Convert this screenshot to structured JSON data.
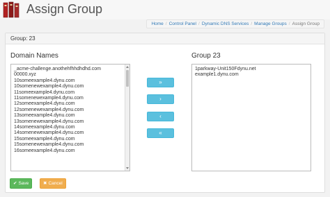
{
  "header": {
    "title": "Assign Group",
    "logo_icon": "books-icon"
  },
  "breadcrumb": [
    "Home",
    "Control Panel",
    "Dynamic DNS Services",
    "Manage Groups",
    "Assign Group"
  ],
  "panel": {
    "heading": "Group: 23"
  },
  "left_list": {
    "label": "Domain Names",
    "items": [
      "_acme-challenge.anothehfhhdhdhd.com",
      "00000.xyz",
      "10someexample4.dynu.com",
      "10somenewexample4.dynu.com",
      "11someexample4.dynu.com",
      "11somenewexample4.dynu.com",
      "12someexample4.dynu.com",
      "12somenewexample4.dynu.com",
      "13someexample4.dynu.com",
      "13somenewexample4.dynu.com",
      "14someexample4.dynu.com",
      "14somenewexample4.dynu.com",
      "15someexample4.dynu.com",
      "15somenewexample4.dynu.com",
      "16someexample4.dynu.com"
    ]
  },
  "right_list": {
    "label": "Group 23",
    "items": [
      "1parkway-Unit150Fdynu.net",
      "example1.dynu.com"
    ]
  },
  "move_buttons": {
    "add_all": "»",
    "add_selected": "›",
    "remove_selected": "‹",
    "remove_all": "«"
  },
  "actions": {
    "save_icon": "✔",
    "save_label": "Save",
    "cancel_icon": "✖",
    "cancel_label": "Cancel"
  },
  "colors": {
    "info": "#5bc0de",
    "success": "#5cb85c",
    "warning": "#f0ad4e",
    "link": "#337ab7"
  }
}
